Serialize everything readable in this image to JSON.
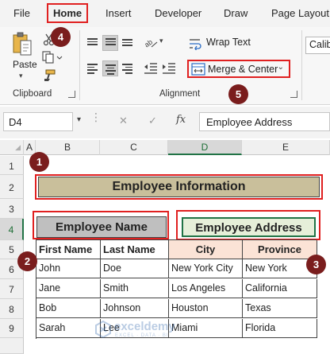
{
  "menu": {
    "items": [
      "File",
      "Home",
      "Insert",
      "Developer",
      "Draw",
      "Page Layout"
    ],
    "active": "Home"
  },
  "ribbon": {
    "clipboard": {
      "paste_label": "Paste",
      "group_label": "Clipboard"
    },
    "alignment": {
      "wrap_text_label": "Wrap Text",
      "merge_center_label": "Merge & Center",
      "group_label": "Alignment"
    },
    "font": {
      "font_name": "Calibri"
    }
  },
  "formula_bar": {
    "name_box": "D4",
    "fx_symbol": "fx",
    "cancel_symbol": "✕",
    "enter_symbol": "✓",
    "formula_value": "Employee Address"
  },
  "grid": {
    "corner_mark": "◢",
    "columns": [
      "A",
      "B",
      "C",
      "D",
      "E"
    ],
    "selected_column": "D",
    "rows": [
      "1",
      "2",
      "3",
      "4",
      "5",
      "6",
      "7",
      "8",
      "9"
    ],
    "selected_row": "4"
  },
  "sheet": {
    "title": "Employee Information",
    "employee_name_header": "Employee Name",
    "employee_address_header": "Employee Address",
    "table_headers": [
      "First Name",
      "Last Name",
      "City",
      "Province"
    ],
    "table_rows": [
      [
        "John",
        "Doe",
        "New York City",
        "New York"
      ],
      [
        "Jane",
        "Smith",
        "Los Angeles",
        "California"
      ],
      [
        "Bob",
        "Johnson",
        "Houston",
        "Texas"
      ],
      [
        "Sarah",
        "Lee",
        "Miami",
        "Florida"
      ]
    ]
  },
  "callouts": [
    "1",
    "2",
    "3",
    "4",
    "5"
  ],
  "watermark": {
    "brand": "exceldemy",
    "tagline": "EXCEL · DATA · BI"
  },
  "colors": {
    "accent_red": "#e02020",
    "callout_badge": "#7a1d1d",
    "title_fill": "#c9bf9b",
    "name_header_fill": "#bfbfbf",
    "address_header_fill": "#e6efd9",
    "city_province_fill": "#fbe3d6",
    "excel_green": "#217346"
  }
}
